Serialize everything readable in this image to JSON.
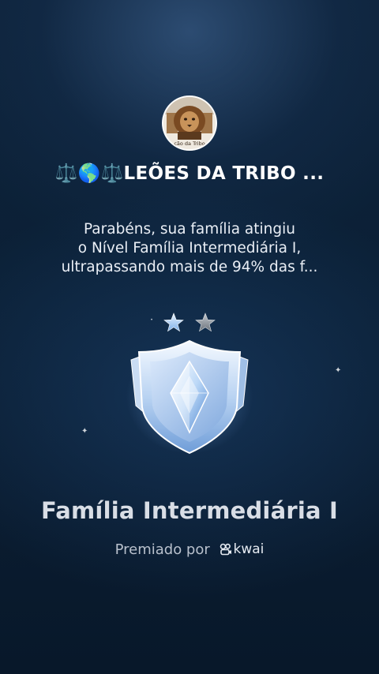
{
  "avatar": {
    "caption": "ção da Tribo"
  },
  "family": {
    "name": "⚖️🌎⚖️LEÕES DA TRIBO ..."
  },
  "message": {
    "line1": "Parabéns, sua família atingiu",
    "line2": "o Nível Família Intermediária I,",
    "line3": "ultrapassando mais de 94% das f..."
  },
  "level": {
    "stars_filled": 1,
    "stars_total": 2,
    "title": "Família Intermediária I"
  },
  "award": {
    "prefix": "Premiado por",
    "brand": "kwai"
  },
  "colors": {
    "background": "#0b2036",
    "badge_light": "#e8f2ff",
    "badge_dark": "#5f8fd0",
    "star_filled": "#bcd7f5",
    "star_empty": "#8e969f"
  },
  "icons": {
    "badge": "shield-crystal-badge-icon",
    "star_filled": "star-filled-icon",
    "star_empty": "star-empty-icon",
    "brand_logo": "kwai-logo-icon"
  }
}
